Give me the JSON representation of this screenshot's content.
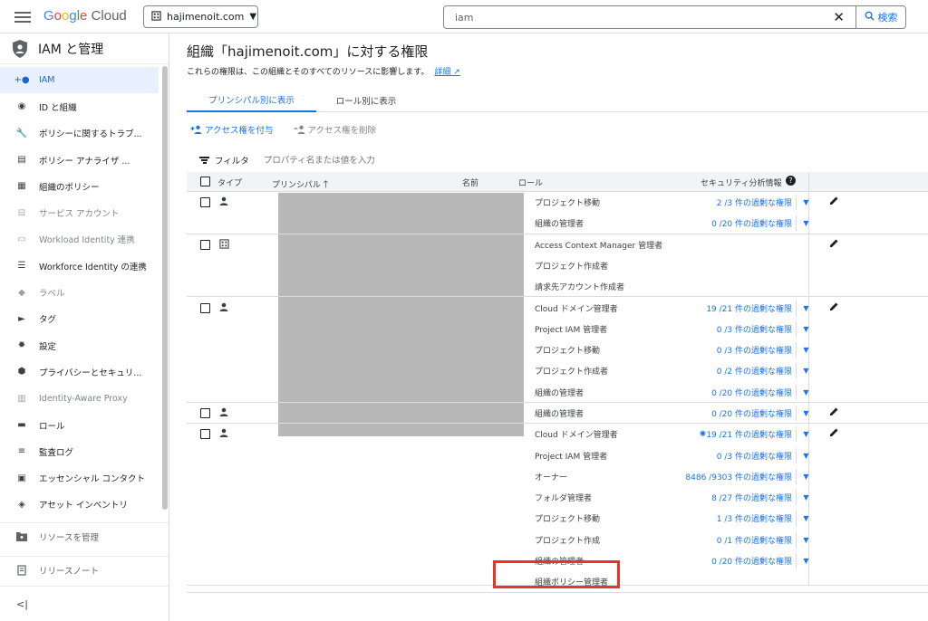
{
  "topbar": {
    "logo": {
      "part1": "G",
      "part2": "o",
      "part3": "o",
      "part4": "g",
      "part5": "l",
      "part6": "e",
      "cloud": " Cloud"
    },
    "project_name": "hajimenoit.com",
    "search_value": "iam",
    "search_button": "検索"
  },
  "sidebar": {
    "title": "IAM と管理",
    "items": [
      {
        "label": "IAM",
        "icon": "person-add-icon",
        "state": "active"
      },
      {
        "label": "ID と組織",
        "icon": "account-circle-icon",
        "state": "normal"
      },
      {
        "label": "ポリシーに関するトラブ...",
        "icon": "wrench-icon",
        "state": "normal"
      },
      {
        "label": "ポリシー アナライザ ...",
        "icon": "policy-analyzer-icon",
        "state": "normal"
      },
      {
        "label": "組織のポリシー",
        "icon": "document-icon",
        "state": "normal"
      },
      {
        "label": "サービス アカウント",
        "icon": "service-account-icon",
        "state": "dim"
      },
      {
        "label": "Workload Identity 連携",
        "icon": "workload-identity-icon",
        "state": "dim"
      },
      {
        "label": "Workforce Identity の連携",
        "icon": "list-icon",
        "state": "normal"
      },
      {
        "label": "ラベル",
        "icon": "label-icon",
        "state": "dim"
      },
      {
        "label": "タグ",
        "icon": "tag-icon",
        "state": "normal"
      },
      {
        "label": "設定",
        "icon": "settings-icon",
        "state": "normal"
      },
      {
        "label": "プライバシーとセキュリ...",
        "icon": "privacy-shield-icon",
        "state": "normal"
      },
      {
        "label": "Identity-Aware Proxy",
        "icon": "iap-icon",
        "state": "dim"
      },
      {
        "label": "ロール",
        "icon": "roles-icon",
        "state": "normal"
      },
      {
        "label": "監査ログ",
        "icon": "audit-log-icon",
        "state": "normal"
      },
      {
        "label": "エッセンシャル コンタクト",
        "icon": "contact-icon",
        "state": "normal"
      },
      {
        "label": "アセット インベントリ",
        "icon": "asset-inventory-icon",
        "state": "normal"
      }
    ],
    "manage_resources": "リソースを管理",
    "release_notes": "リリースノート",
    "collapse": "<|"
  },
  "main": {
    "title": "組織「hajimenoit.com」に対する権限",
    "description": "これらの権限は、この組織とそのすべてのリソースに影響します。",
    "details_link": "詳細",
    "tabs": [
      "プリンシパル別に表示",
      "ロール別に表示"
    ],
    "grant_access": "アクセス権を付与",
    "remove_access": "アクセス権を削除",
    "filter_label": "フィルタ",
    "filter_placeholder": "プロパティ名または値を入力",
    "columns": {
      "type": "タイプ",
      "principal": "プリンシパル",
      "name": "名前",
      "role": "ロール",
      "security": "セキュリティ分析情報"
    }
  },
  "groups": [
    {
      "type_icon": "person-icon",
      "roles": [
        {
          "role": "プロジェクト移動",
          "insight": "2 /3 件の過剰な権限"
        },
        {
          "role": "組織の管理者",
          "insight": "0 /20 件の過剰な権限"
        }
      ]
    },
    {
      "type_icon": "organization-icon",
      "roles": [
        {
          "role": "Access Context Manager 管理者",
          "insight": ""
        },
        {
          "role": "プロジェクト作成者",
          "insight": ""
        },
        {
          "role": "請求先アカウント作成者",
          "insight": ""
        }
      ]
    },
    {
      "type_icon": "person-icon",
      "roles": [
        {
          "role": "Cloud ドメイン管理者",
          "insight": "19 /21 件の過剰な権限"
        },
        {
          "role": "Project IAM 管理者",
          "insight": "0 /3 件の過剰な権限"
        },
        {
          "role": "プロジェクト移動",
          "insight": "0 /3 件の過剰な権限"
        },
        {
          "role": "プロジェクト作成者",
          "insight": "0 /2 件の過剰な権限"
        },
        {
          "role": "組織の管理者",
          "insight": "0 /20 件の過剰な権限"
        }
      ]
    },
    {
      "type_icon": "person-icon",
      "roles": [
        {
          "role": "組織の管理者",
          "insight": "0 /20 件の過剰な権限"
        }
      ]
    },
    {
      "type_icon": "person-icon",
      "roles": [
        {
          "role": "Cloud ドメイン管理者",
          "insight": "19 /21 件の過剰な権限"
        },
        {
          "role": "Project IAM 管理者",
          "insight": "0 /3 件の過剰な権限"
        },
        {
          "role": "オーナー",
          "insight": "8486 /9303 件の過剰な権限"
        },
        {
          "role": "フォルダ管理者",
          "insight": "8 /27 件の過剰な権限"
        },
        {
          "role": "プロジェクト移動",
          "insight": "1 /3 件の過剰な権限"
        },
        {
          "role": "プロジェクト作成",
          "insight": "0 /1 件の過剰な権限"
        },
        {
          "role": "組織の管理者",
          "insight": "0 /20 件の過剰な権限"
        },
        {
          "role": "組織ポリシー管理者",
          "insight": ""
        }
      ]
    }
  ],
  "colors": {
    "accent": "#1a73e8",
    "highlight": "#ea3323",
    "active_bg": "#e8f0fe"
  }
}
